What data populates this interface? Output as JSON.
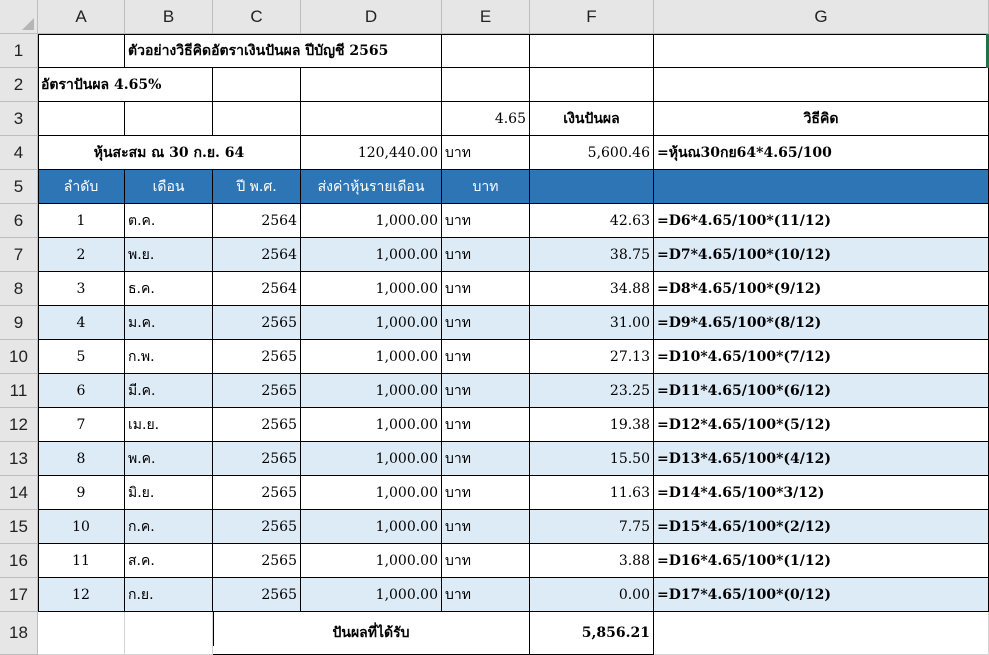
{
  "columns": [
    "A",
    "B",
    "C",
    "D",
    "E",
    "F",
    "G"
  ],
  "rows": [
    "1",
    "2",
    "3",
    "4",
    "5",
    "6",
    "7",
    "8",
    "9",
    "10",
    "11",
    "12",
    "13",
    "14",
    "15",
    "16",
    "17",
    "18"
  ],
  "sheet": {
    "title": "ตัวอย่างวิธีคิดอัตราเงินปันผล ปีบัญชี 2565",
    "rate_label": "อัตราปันผล 4.65%",
    "rate_value": "4.65",
    "dividend_header": "เงินปันผล",
    "method_header": "วิธีคิด",
    "accum_label": "หุ้นสะสม ณ 30 ก.ย. 64",
    "accum_value": "120,440.00",
    "accum_unit": "บาท",
    "accum_dividend": "5,600.46",
    "accum_formula": "=หุ้นณ30กย64*4.65/100",
    "headers": [
      "ลำดับ",
      "เดือน",
      "ปี พ.ศ.",
      "ส่งค่าหุ้นรายเดือน",
      "บาท",
      "",
      ""
    ],
    "total_label": "ปันผลที่ได้รับ",
    "total_value": "5,856.21"
  },
  "table_rows": [
    {
      "no": "1",
      "month": "ต.ค.",
      "year": "2564",
      "amount": "1,000.00",
      "unit": "บาท",
      "dividend": "42.63",
      "formula": "=D6*4.65/100*(11/12)"
    },
    {
      "no": "2",
      "month": "พ.ย.",
      "year": "2564",
      "amount": "1,000.00",
      "unit": "บาท",
      "dividend": "38.75",
      "formula": "=D7*4.65/100*(10/12)"
    },
    {
      "no": "3",
      "month": "ธ.ค.",
      "year": "2564",
      "amount": "1,000.00",
      "unit": "บาท",
      "dividend": "34.88",
      "formula": "=D8*4.65/100*(9/12)"
    },
    {
      "no": "4",
      "month": "ม.ค.",
      "year": "2565",
      "amount": "1,000.00",
      "unit": "บาท",
      "dividend": "31.00",
      "formula": "=D9*4.65/100*(8/12)"
    },
    {
      "no": "5",
      "month": "ก.พ.",
      "year": "2565",
      "amount": "1,000.00",
      "unit": "บาท",
      "dividend": "27.13",
      "formula": "=D10*4.65/100*(7/12)"
    },
    {
      "no": "6",
      "month": "มี.ค.",
      "year": "2565",
      "amount": "1,000.00",
      "unit": "บาท",
      "dividend": "23.25",
      "formula": "=D11*4.65/100*(6/12)"
    },
    {
      "no": "7",
      "month": "เม.ย.",
      "year": "2565",
      "amount": "1,000.00",
      "unit": "บาท",
      "dividend": "19.38",
      "formula": "=D12*4.65/100*(5/12)"
    },
    {
      "no": "8",
      "month": "พ.ค.",
      "year": "2565",
      "amount": "1,000.00",
      "unit": "บาท",
      "dividend": "15.50",
      "formula": "=D13*4.65/100*(4/12)"
    },
    {
      "no": "9",
      "month": "มิ.ย.",
      "year": "2565",
      "amount": "1,000.00",
      "unit": "บาท",
      "dividend": "11.63",
      "formula": "=D14*4.65/100*3/12)"
    },
    {
      "no": "10",
      "month": "ก.ค.",
      "year": "2565",
      "amount": "1,000.00",
      "unit": "บาท",
      "dividend": "7.75",
      "formula": "=D15*4.65/100*(2/12)"
    },
    {
      "no": "11",
      "month": "ส.ค.",
      "year": "2565",
      "amount": "1,000.00",
      "unit": "บาท",
      "dividend": "3.88",
      "formula": "=D16*4.65/100*(1/12)"
    },
    {
      "no": "12",
      "month": "ก.ย.",
      "year": "2565",
      "amount": "1,000.00",
      "unit": "บาท",
      "dividend": "0.00",
      "formula": "=D17*4.65/100*(0/12)"
    }
  ],
  "colors": {
    "header_fill": "#2e75b6",
    "band_fill": "#ddebf7",
    "grid_header": "#e6e6e6"
  }
}
